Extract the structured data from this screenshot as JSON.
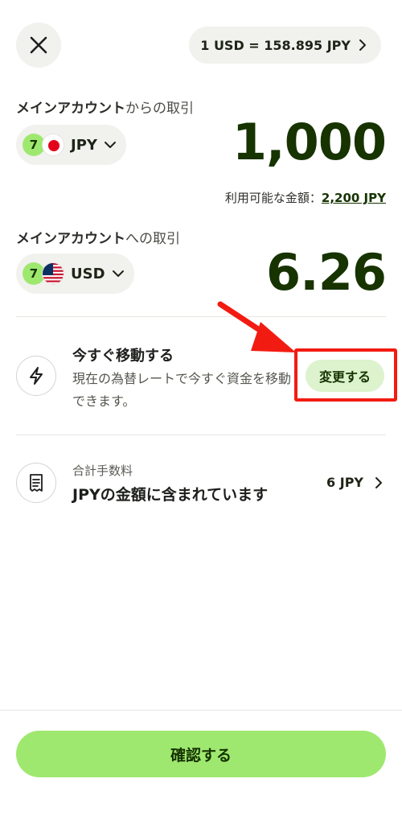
{
  "header": {
    "rate_text": "1 USD = 158.895 JPY"
  },
  "from": {
    "label_main": "メインアカウント",
    "label_suffix": "からの取引",
    "logo_glyph": "7",
    "currency": "JPY",
    "amount": "1,000",
    "available_label": "利用可能な金額：",
    "available_value": "2,200 JPY"
  },
  "to": {
    "label_main": "メインアカウント",
    "label_suffix": "への取引",
    "logo_glyph": "7",
    "currency": "USD",
    "amount": "6.26"
  },
  "transfer_speed": {
    "title": "今すぐ移動する",
    "description": "現在の為替レートで今すぐ資金を移動できます。",
    "change_label": "変更する"
  },
  "fee": {
    "subtitle": "合計手数料",
    "title": "JPYの金額に含まれています",
    "value": "6 JPY"
  },
  "footer": {
    "confirm_label": "確認する"
  },
  "colors": {
    "brand_green": "#9fe870",
    "brand_dark": "#163300",
    "highlight_red": "#f21b12"
  },
  "icons": [
    "close-icon",
    "chevron-right-icon",
    "chevron-down-icon",
    "japan-flag-icon",
    "usa-flag-icon",
    "lightning-icon",
    "receipt-icon",
    "red-arrow-annotation"
  ]
}
